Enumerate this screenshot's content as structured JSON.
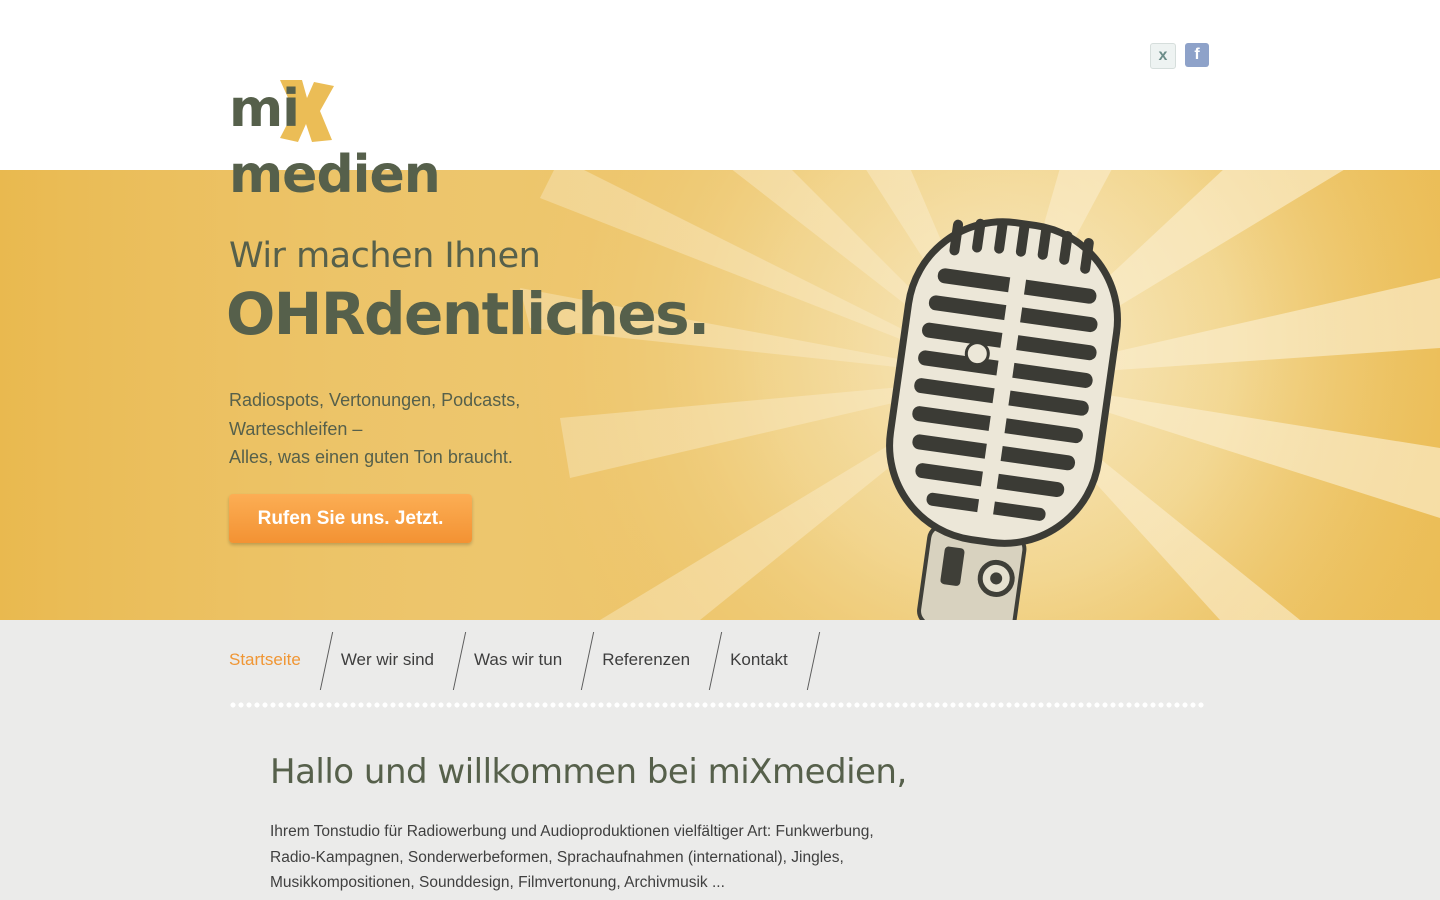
{
  "brand": {
    "logo_text": "mimedien",
    "logo_x_letter": "X",
    "colors": {
      "olive": "#56604b",
      "yellow": "#ebbd56",
      "orange": "#f39233",
      "grey_bg": "#ebebea"
    }
  },
  "social": {
    "xing_icon_glyph": "x",
    "facebook_icon_glyph": "f"
  },
  "hero": {
    "tagline_small": "Wir machen Ihnen",
    "tagline_big": "OHRdentliches.",
    "text_lines": [
      "Radiospots, Vertonungen, Podcasts,",
      "Warteschleifen –",
      "Alles, was einen guten Ton braucht."
    ],
    "cta_label": "Rufen Sie uns. Jetzt."
  },
  "nav": {
    "items": [
      {
        "label": "Startseite"
      },
      {
        "label": "Wer wir sind"
      },
      {
        "label": "Was wir tun"
      },
      {
        "label": "Referenzen"
      },
      {
        "label": "Kontakt"
      }
    ]
  },
  "welcome": {
    "title": "Hallo und willkommen bei miXmedien,",
    "lines": [
      "Ihrem Tonstudio für Radiowerbung und Audioproduktionen vielfältiger Art: Funkwerbung,",
      "Radio-Kampagnen, Sonderwerbeformen, Sprachaufnahmen (international), Jingles,",
      "Musikkompositionen, Sounddesign, Filmvertonung, Archivmusik ..."
    ]
  }
}
